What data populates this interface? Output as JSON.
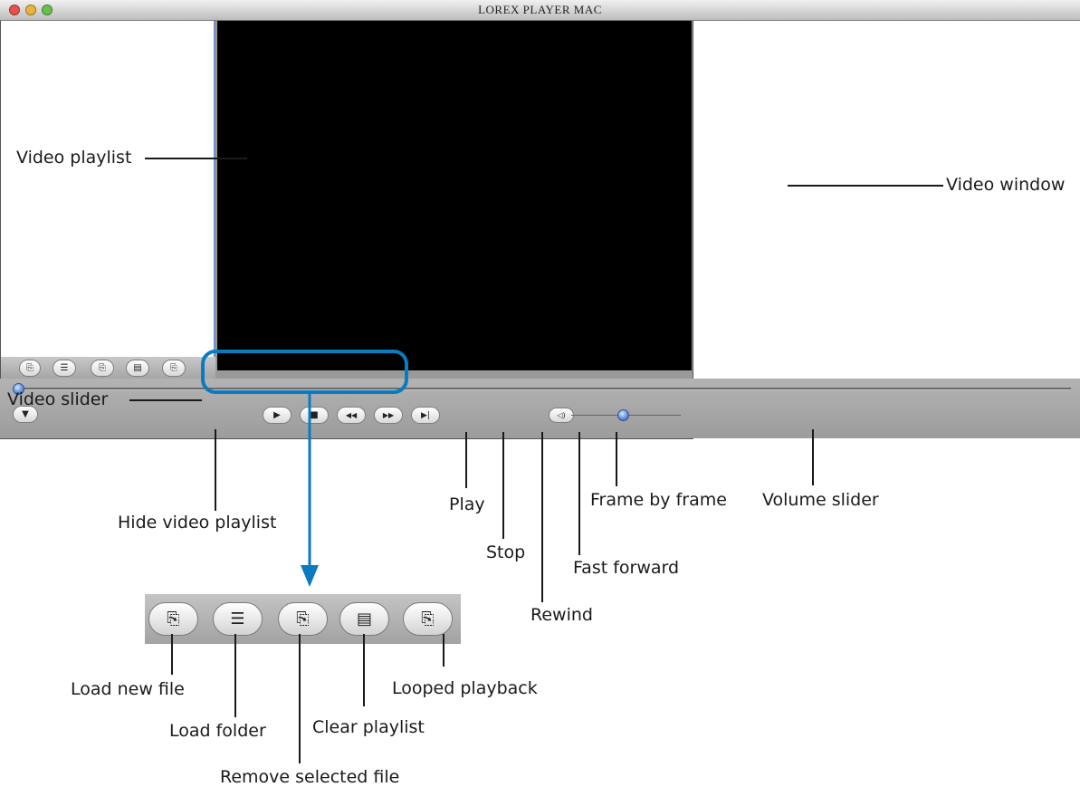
{
  "window": {
    "title": "LOREX PLAYER MAC",
    "traffic_colors": [
      "#e8504a",
      "#e8b43a",
      "#67c04a"
    ]
  },
  "playlist_toolbar": {
    "buttons": [
      {
        "icon": "load-new-file-icon",
        "glyph": "⎘"
      },
      {
        "icon": "load-folder-icon",
        "glyph": "☰"
      },
      {
        "icon": "remove-file-icon",
        "glyph": "⎘"
      },
      {
        "icon": "clear-playlist-icon",
        "glyph": "▤"
      },
      {
        "icon": "looped-playback-icon",
        "glyph": "⎘"
      }
    ]
  },
  "controls": {
    "hide_playlist_glyph": "▼",
    "play_glyph": "▶",
    "stop_glyph": "■",
    "rewind_glyph": "◀◀",
    "fast_forward_glyph": "▶▶",
    "frame_glyph": "▶|",
    "volume_glyph": "◁)"
  },
  "labels": {
    "video_playlist": "Video playlist",
    "video_window": "Video window",
    "video_slider": "Video slider",
    "hide_video_playlist": "Hide video playlist",
    "play": "Play",
    "stop": "Stop",
    "rewind": "Rewind",
    "fast_forward": "Fast forward",
    "frame_by_frame": "Frame by frame",
    "volume_slider": "Volume slider",
    "load_new_file": "Load new file",
    "load_folder": "Load folder",
    "remove_selected_file": "Remove selected file",
    "clear_playlist": "Clear playlist",
    "looped_playback": "Looped playback"
  },
  "colors": {
    "highlight": "#0a7bc0",
    "video_background": "#000000"
  }
}
